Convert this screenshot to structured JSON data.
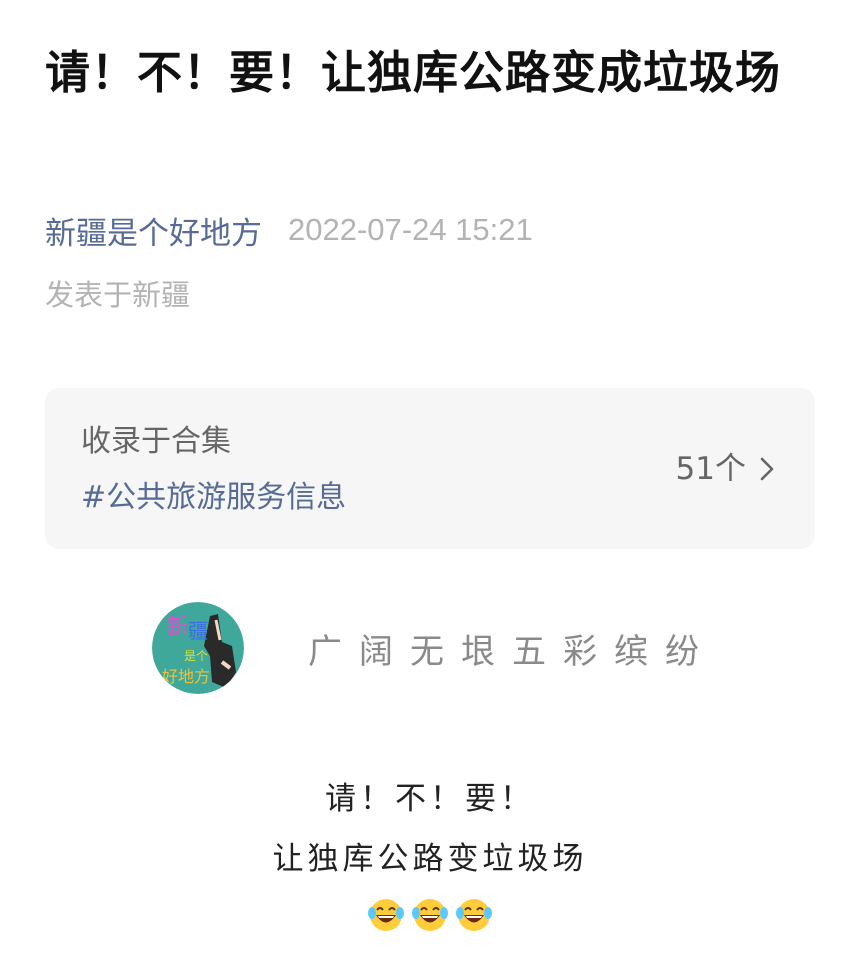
{
  "article": {
    "title": "请！不！要！让独库公路变成垃圾场",
    "author": "新疆是个好地方",
    "date": "2022-07-24 15:21",
    "location": "发表于新疆"
  },
  "collection": {
    "label": "收录于合集",
    "tag": "#公共旅游服务信息",
    "count": "51个"
  },
  "profile": {
    "avatar_text": [
      "新",
      "疆",
      "是个",
      "好地方"
    ],
    "slogan": "广阔无垠五彩缤纷"
  },
  "content": {
    "line1": "请！不！要！",
    "line2": "让独库公路变垃圾场",
    "emojis": [
      "laughing-tears-emoji",
      "laughing-tears-emoji",
      "laughing-tears-emoji"
    ]
  },
  "colors": {
    "link": "#576b95",
    "muted": "#b3b3b3",
    "card_bg": "#f6f6f6",
    "avatar_bg": "#3fa89a"
  }
}
